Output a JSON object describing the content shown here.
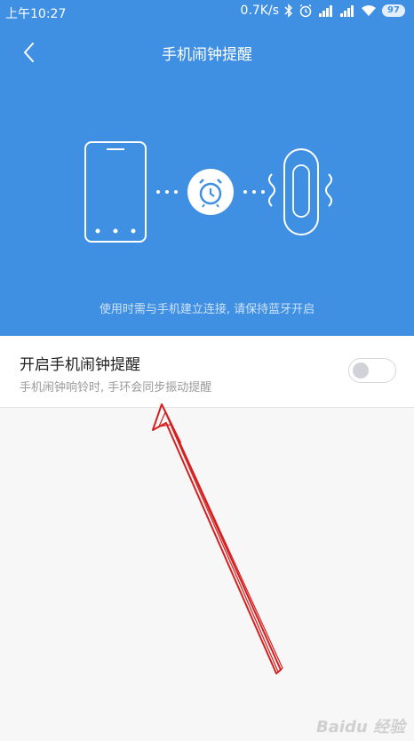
{
  "status_bar": {
    "time": "上午10:27",
    "speed": "0.7K/s",
    "battery": "97",
    "icons": [
      "bluetooth-icon",
      "alarm-icon",
      "signal-icon",
      "signal-icon",
      "wifi-icon",
      "battery-icon"
    ]
  },
  "header": {
    "title": "手机闹钟提醒",
    "back_icon": "back-arrow-icon"
  },
  "hero": {
    "background_color": "#3f8fe3",
    "hint": "使用时需与手机建立连接, 请保持蓝牙开启",
    "illustration_icons": [
      "phone-icon",
      "alarm-clock-icon",
      "band-icon"
    ]
  },
  "setting": {
    "title": "开启手机闹钟提醒",
    "description": "手机闹钟响铃时, 手环会同步振动提醒",
    "toggle_on": false
  },
  "annotation": {
    "arrow_color": "#d62020"
  },
  "watermark": {
    "text": "Baidu 经验"
  }
}
